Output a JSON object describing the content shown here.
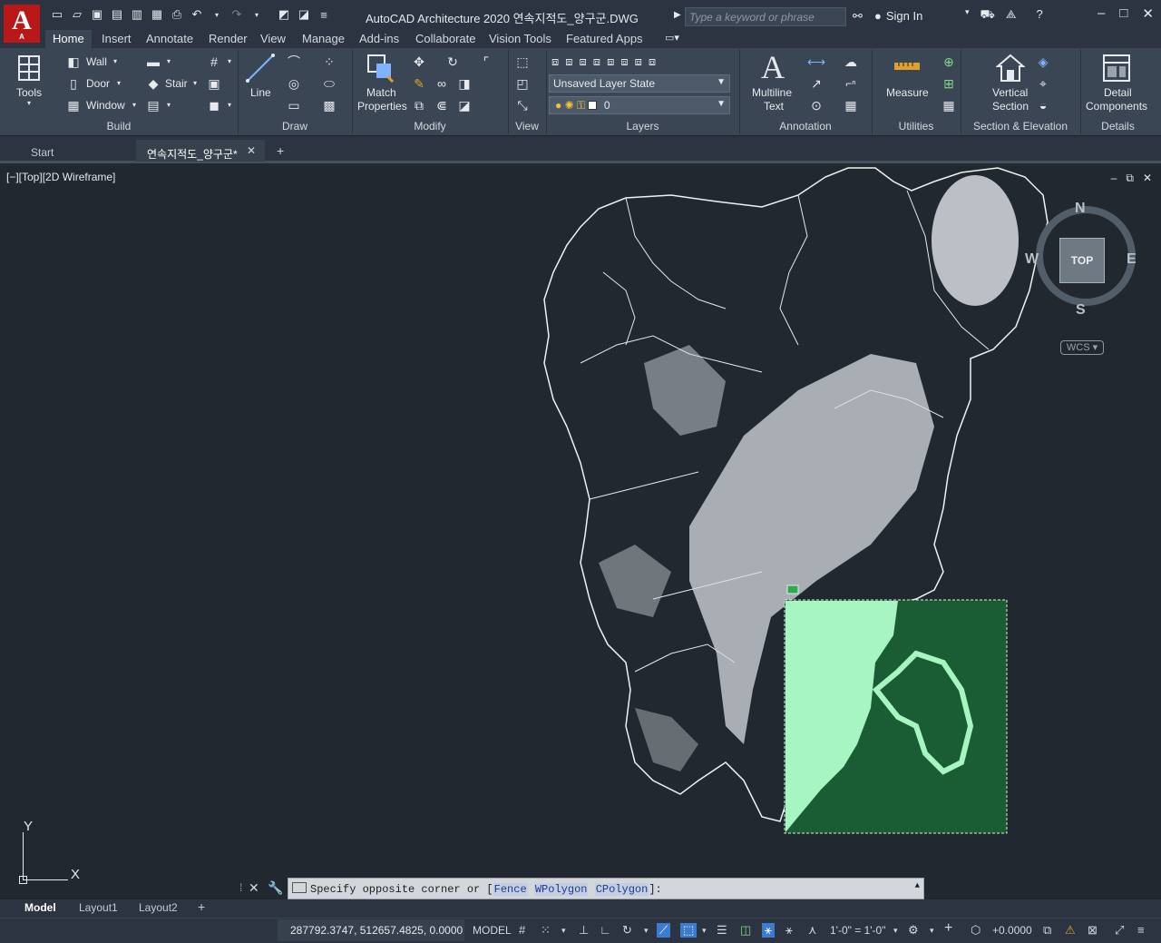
{
  "app": {
    "logo_letter": "A",
    "logo_sub": "A",
    "title": "AutoCAD Architecture 2020    연속지적도_양구군.DWG",
    "search_placeholder": "Type a keyword or phrase",
    "sign_in": "Sign In"
  },
  "ribbon_tabs": [
    "Home",
    "Insert",
    "Annotate",
    "Render",
    "View",
    "Manage",
    "Add-ins",
    "Collaborate",
    "Vision Tools",
    "Featured Apps"
  ],
  "ribbon": {
    "tools_label": "Tools",
    "wall_label": "Wall",
    "door_label": "Door",
    "window_label": "Window",
    "stair_label": "Stair",
    "build_title": "Build",
    "line_label": "Line",
    "draw_title": "Draw",
    "match_label": "Match",
    "properties_label": "Properties",
    "modify_title": "Modify",
    "view_title": "View",
    "layer_state": "Unsaved Layer State",
    "layer_current": "0",
    "layers_title": "Layers",
    "multiline_label": "Multiline",
    "text_label": "Text",
    "annotation_title": "Annotation",
    "measure_label": "Measure",
    "utilities_title": "Utilities",
    "vertical_label": "Vertical",
    "section_label": "Section",
    "section_elevation_title": "Section & Elevation",
    "detail_label": "Detail",
    "components_label": "Components",
    "details_title": "Details"
  },
  "doc_tabs": {
    "start": "Start",
    "active": "연속지적도_양구군*"
  },
  "viewport": {
    "label": "[−][Top][2D Wireframe]"
  },
  "viewcube": {
    "face": "TOP",
    "north": "N",
    "south": "S",
    "east": "E",
    "west": "W",
    "wcs": "WCS"
  },
  "ucs": {
    "x": "X",
    "y": "Y"
  },
  "command": {
    "prompt": "Specify opposite corner or [",
    "opt1_hot": "F",
    "opt1_rest": "ence",
    "opt2_hot": "WP",
    "opt2_rest": "olygon",
    "opt3_hot": "CP",
    "opt3_rest": "olygon",
    "end": "]:"
  },
  "layout_tabs": [
    "Model",
    "Layout1",
    "Layout2"
  ],
  "status": {
    "coords": "287792.3747, 512657.4825, 0.0000",
    "model": "MODEL",
    "scale": "1'-0\" = 1'-0\"",
    "elevation": "+0.0000"
  },
  "colors": {
    "canvas_bg": "#212830",
    "window_fill": "#1a5c33",
    "window_highlight": "#a7f5c0",
    "accent": "#3b7bd0"
  }
}
